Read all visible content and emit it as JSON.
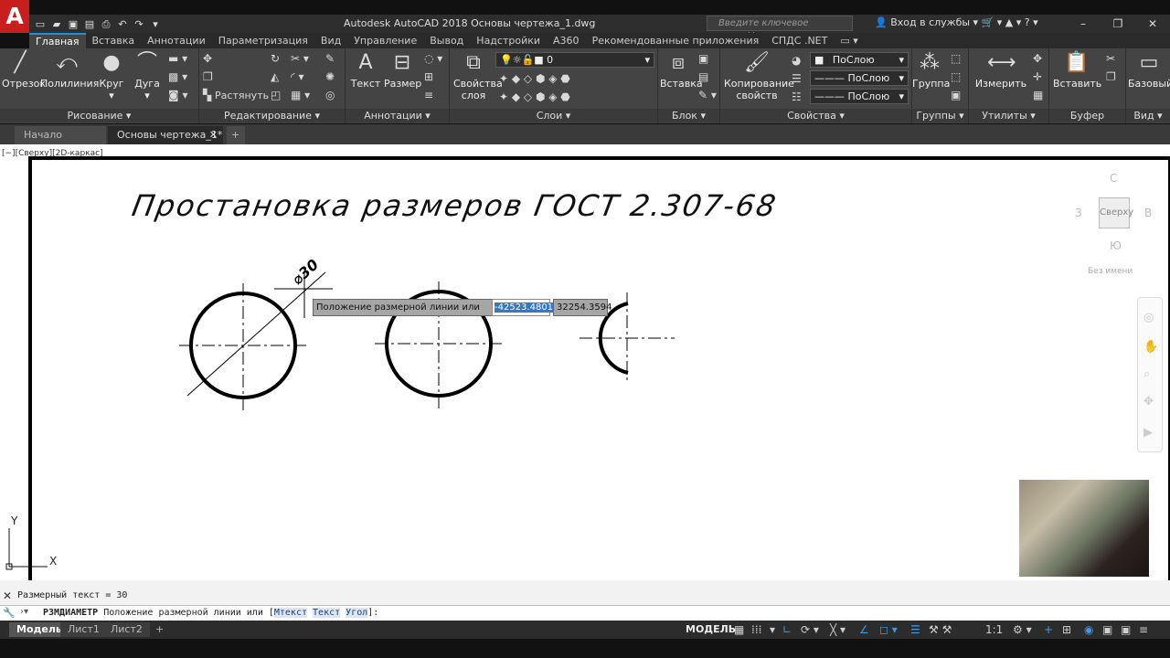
{
  "app": {
    "title": "Autodesk AutoCAD 2018    Основы чертежа_1.dwg",
    "logo": "A",
    "search_placeholder": "Введите ключевое слово/фразу",
    "login": "Вход в службы",
    "window_controls": [
      "–",
      "❐",
      "✕"
    ]
  },
  "ribbon_tabs": [
    "Главная",
    "Вставка",
    "Аннотации",
    "Параметризация",
    "Вид",
    "Управление",
    "Вывод",
    "Надстройки",
    "A360",
    "Рекомендованные приложения",
    "СПДС .NET"
  ],
  "panels": {
    "draw": {
      "title": "Рисование ▾",
      "line": "Отрезок",
      "polyline": "Полилиния",
      "circle": "Круг",
      "arc": "Дуга"
    },
    "modify": {
      "title": "Редактирование ▾",
      "stretch": "Растянуть"
    },
    "annotation": {
      "title": "Аннотации ▾",
      "text": "Текст",
      "dimension": "Размер"
    },
    "layers": {
      "title": "Слои ▾",
      "layer_props": "Свойства слоя",
      "current_layer": "0"
    },
    "block": {
      "title": "Блок ▾",
      "insert": "Вставка"
    },
    "properties": {
      "title": "Свойства ▾",
      "match": "Копирование свойств",
      "color": "ПоСлою",
      "linetype": "ПоСлою",
      "lineweight": "ПоСлою"
    },
    "groups": {
      "title": "Группы ▾",
      "group": "Группа"
    },
    "utilities": {
      "title": "Утилиты ▾",
      "measure": "Измерить"
    },
    "clipboard": {
      "title": "Буфер обмена",
      "paste": "Вставить"
    },
    "view": {
      "title": "Вид ▾",
      "base": "Базовый"
    }
  },
  "file_tabs": [
    "Начало",
    "Основы чертежа_1*"
  ],
  "viewport": {
    "label": "[−][Сверху][2D-каркас]",
    "drawing_title": "Простановка размеров ГОСТ 2.307-68",
    "dim_text": "⌀30",
    "dynamic_prompt": "Положение размерной линии или",
    "input_x": "-42523.4801",
    "input_y": "32254.3594",
    "viewcube": {
      "n": "С",
      "s": "Ю",
      "w": "З",
      "e": "В",
      "face": "Сверху",
      "name": "Без имени"
    },
    "ucs_x": "X",
    "ucs_y": "Y"
  },
  "command": {
    "history": "Размерный текст = 30",
    "prefix": "РЗМДИАМЕТР",
    "prompt": " Положение размерной линии или [",
    "opt1": "Мтекст",
    "opt2": "Текст",
    "opt3": "Угол",
    "suffix": "]:"
  },
  "status": {
    "layout_tabs": [
      "Модель",
      "Лист1",
      "Лист2"
    ],
    "add_tab": "+",
    "model": "МОДЕЛЬ",
    "scale": "1:1"
  }
}
